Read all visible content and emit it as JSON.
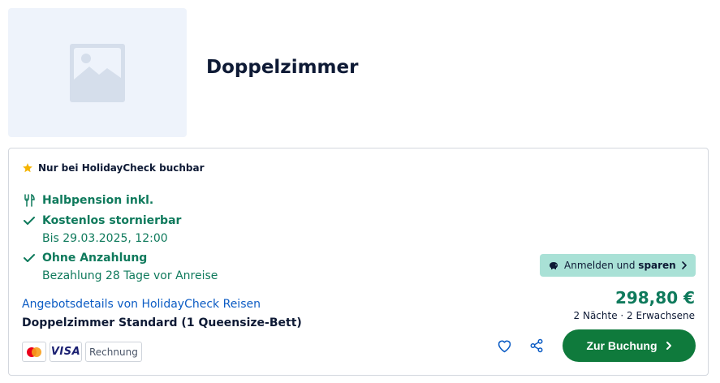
{
  "room": {
    "title": "Doppelzimmer",
    "image_icon": "image-placeholder-icon"
  },
  "offer": {
    "exclusive_label": "Nur bei HolidayCheck buchbar",
    "features": [
      {
        "icon": "cutlery-icon",
        "main": "Halbpension inkl.",
        "sub": ""
      },
      {
        "icon": "check-icon",
        "main": "Kostenlos stornierbar",
        "sub": "Bis 29.03.2025, 12:00"
      },
      {
        "icon": "check-icon",
        "main": "Ohne Anzahlung",
        "sub": "Bezahlung 28 Tage vor Anreise"
      }
    ],
    "login_badge": {
      "prefix": "Anmelden und",
      "bold": "sparen"
    },
    "details_link": "Angebotsdetails von HolidayCheck Reisen",
    "room_name": "Doppelzimmer Standard (1 Queensize-Bett)",
    "payments": {
      "mastercard": "mastercard-logo",
      "visa": "VISA",
      "invoice": "Rechnung"
    },
    "price": "298,80 €",
    "price_sub": "2 Nächte · 2 Erwachsene",
    "book_label": "Zur Buchung"
  },
  "colors": {
    "green": "#0f7a5c",
    "button": "#0f7a3c",
    "badge": "#a9e1d6",
    "link": "#0c5cc4"
  }
}
